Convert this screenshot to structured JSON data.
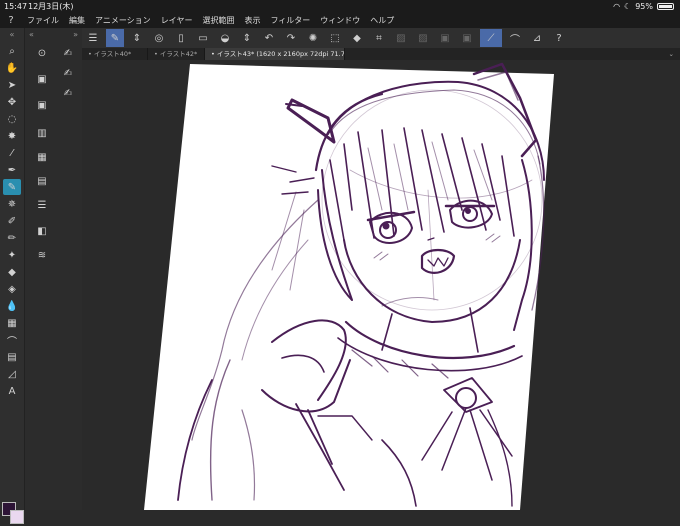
{
  "status": {
    "time": "15:47",
    "date": "12月3日(木)",
    "battery": "95%"
  },
  "menu": {
    "logo": "?",
    "items": [
      "ファイル",
      "編集",
      "アニメーション",
      "レイヤー",
      "選択範囲",
      "表示",
      "フィルター",
      "ウィンドウ",
      "ヘルプ"
    ]
  },
  "tabs": [
    {
      "label": "• イラスト40*"
    },
    {
      "label": "• イラスト42*"
    },
    {
      "label": "• イラスト43* (1620 x 2160px 72dpi 71.7%)"
    }
  ],
  "colors": {
    "main": "#2d1436",
    "sub": "#ead8ef",
    "accent": "#4a6aa8",
    "tool_accent": "#2a8fb0"
  }
}
